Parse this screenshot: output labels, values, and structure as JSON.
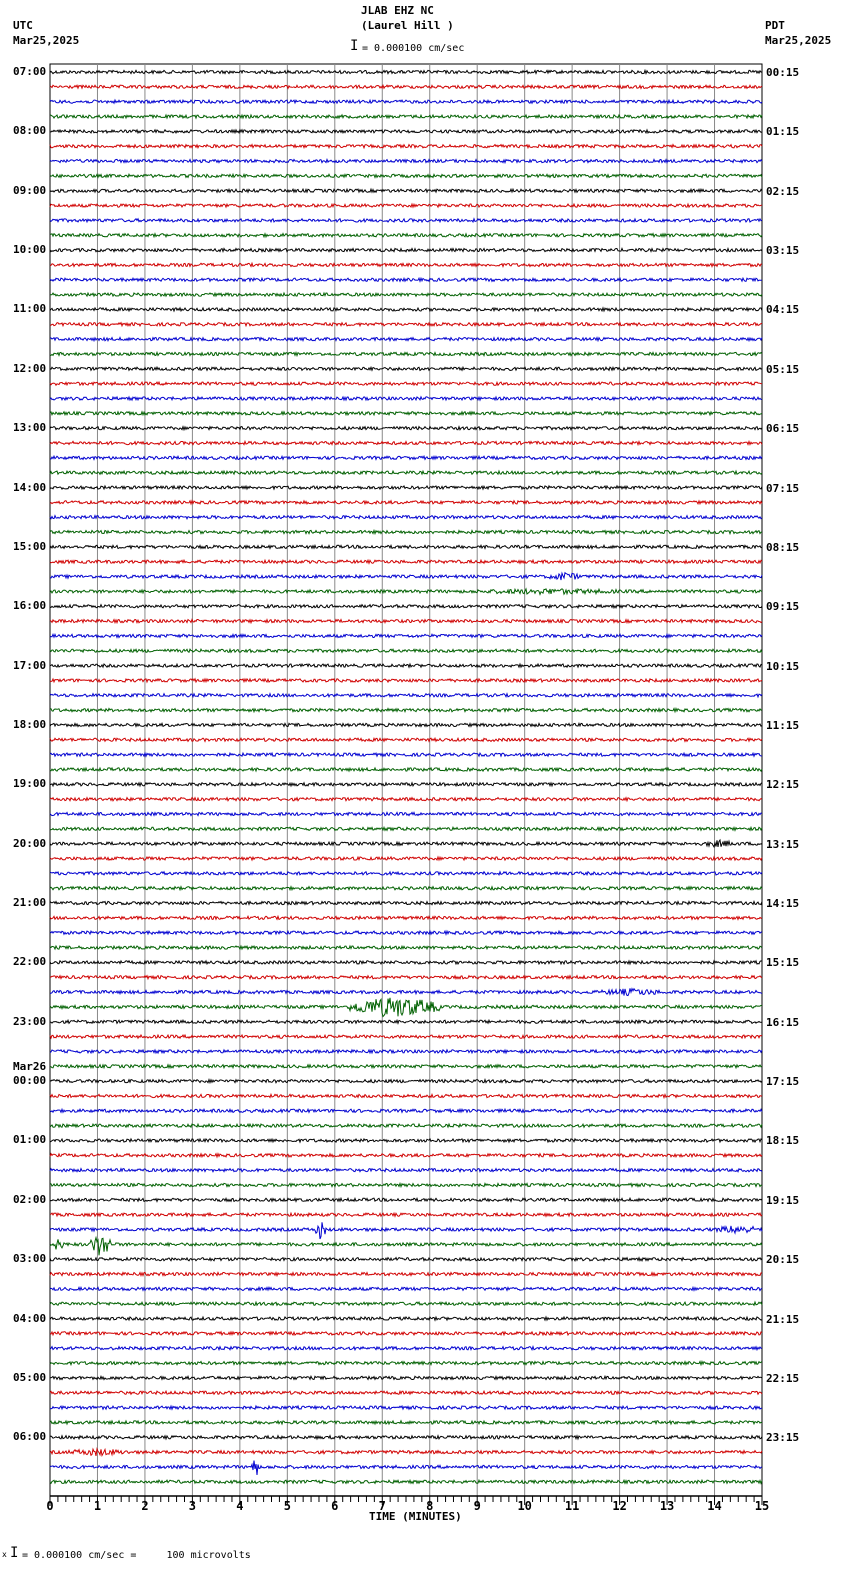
{
  "header": {
    "title": "JLAB EHZ NC",
    "subtitle": "(Laurel Hill )",
    "left_tz": "UTC",
    "left_date": "Mar25,2025",
    "right_tz": "PDT",
    "right_date": "Mar25,2025",
    "scale": "= 0.000100 cm/sec"
  },
  "footer": {
    "scale": "= 0.000100 cm/sec =     100 microvolts",
    "prefix": "x"
  },
  "chart_data": {
    "type": "line",
    "title": "JLAB EHZ NC (Laurel Hill )",
    "xlabel": "TIME (MINUTES)",
    "xlim": [
      0,
      15
    ],
    "x_ticks": [
      "0",
      "1",
      "2",
      "3",
      "4",
      "5",
      "6",
      "7",
      "8",
      "9",
      "10",
      "11",
      "12",
      "13",
      "14",
      "15"
    ],
    "trace_colors": [
      "#000000",
      "#d00000",
      "#0000d0",
      "#006000"
    ],
    "traces_per_hour": 4,
    "left_labels": [
      "07:00",
      "08:00",
      "09:00",
      "10:00",
      "11:00",
      "12:00",
      "13:00",
      "14:00",
      "15:00",
      "16:00",
      "17:00",
      "18:00",
      "19:00",
      "20:00",
      "21:00",
      "22:00",
      "23:00",
      "00:00",
      "01:00",
      "02:00",
      "03:00",
      "04:00",
      "05:00",
      "06:00"
    ],
    "date_change": {
      "label": "Mar26",
      "hour_index": 17
    },
    "right_labels": [
      "00:15",
      "01:15",
      "02:15",
      "03:15",
      "04:15",
      "05:15",
      "06:15",
      "07:15",
      "08:15",
      "09:15",
      "10:15",
      "11:15",
      "12:15",
      "13:15",
      "14:15",
      "15:15",
      "16:15",
      "17:15",
      "18:15",
      "19:15",
      "20:15",
      "21:15",
      "22:15",
      "23:15"
    ],
    "events": [
      {
        "trace": 34,
        "start": 10.5,
        "end": 11.2,
        "amp": 3
      },
      {
        "trace": 35,
        "start": 8.5,
        "end": 12.5,
        "amp": 2
      },
      {
        "trace": 52,
        "start": 13.7,
        "end": 14.5,
        "amp": 2.5
      },
      {
        "trace": 62,
        "start": 11.5,
        "end": 13.0,
        "amp": 2.5
      },
      {
        "trace": 63,
        "start": 6.3,
        "end": 8.2,
        "amp": 7
      },
      {
        "trace": 78,
        "start": 5.6,
        "end": 5.8,
        "amp": 7
      },
      {
        "trace": 78,
        "start": 14.0,
        "end": 15.0,
        "amp": 3
      },
      {
        "trace": 79,
        "start": 0.0,
        "end": 0.3,
        "amp": 4
      },
      {
        "trace": 79,
        "start": 0.85,
        "end": 1.3,
        "amp": 8
      },
      {
        "trace": 93,
        "start": 0.3,
        "end": 1.7,
        "amp": 2.5
      },
      {
        "trace": 94,
        "start": 4.25,
        "end": 4.4,
        "amp": 8
      }
    ]
  }
}
